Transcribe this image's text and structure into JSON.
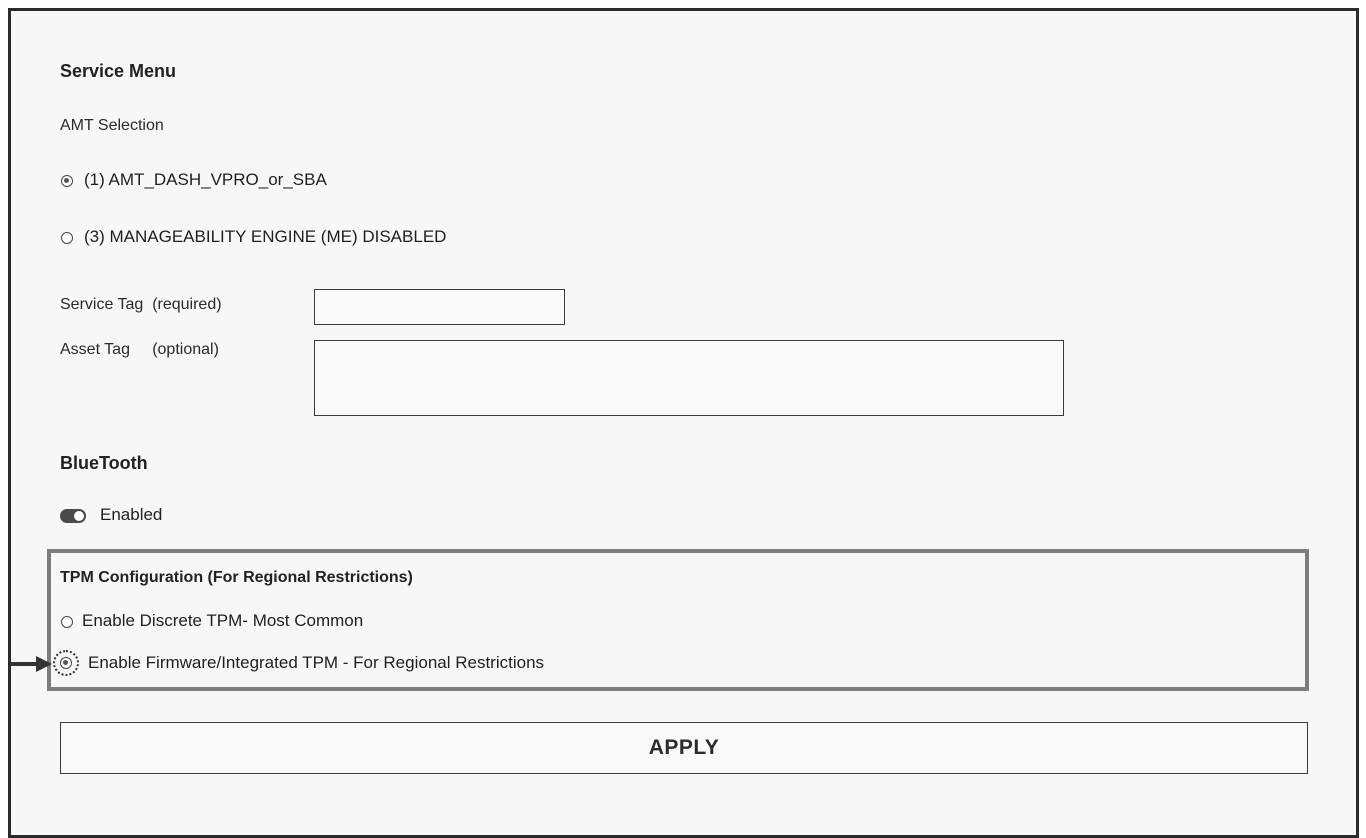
{
  "service_menu": {
    "title": "Service Menu",
    "amt_selection_label": "AMT Selection",
    "amt_options": [
      {
        "label": "(1)  AMT_DASH_VPRO_or_SBA",
        "selected": true
      },
      {
        "label": "(3)  MANAGEABILITY ENGINE (ME) DISABLED",
        "selected": false
      }
    ],
    "service_tag": {
      "label": "Service Tag  (required)",
      "value": ""
    },
    "asset_tag": {
      "label": "Asset Tag     (optional)",
      "value": ""
    }
  },
  "bluetooth": {
    "title": "BlueTooth",
    "toggle_label": "Enabled",
    "enabled": true
  },
  "tpm": {
    "title": "TPM Configuration (For Regional Restrictions)",
    "options": [
      {
        "label": "Enable Discrete TPM- Most Common",
        "selected": false
      },
      {
        "label": "Enable Firmware/Integrated TPM - For Regional Restrictions",
        "selected": true
      }
    ]
  },
  "apply_label": "APPLY",
  "colors": {
    "frame_border": "#2b2b2b",
    "tpm_box_border": "#7d7d7d",
    "toggle_on": "#4a4a4a"
  }
}
